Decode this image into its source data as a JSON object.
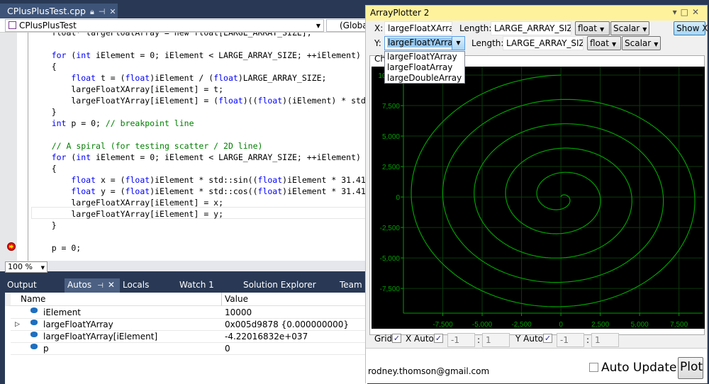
{
  "ide": {
    "doc_tab": "CPlusPlusTest.cpp",
    "nav_scope": "CPlusPlusTest",
    "nav_member": "(Global",
    "code_lines": [
      [
        [
          "    float* largeFloatArray = new float[LARGE_ARRAY_SIZE];",
          ""
        ]
      ],
      [
        [
          "",
          ""
        ]
      ],
      [
        [
          "    ",
          ""
        ],
        [
          "for",
          "kw"
        ],
        [
          " (",
          ""
        ],
        [
          "int",
          "kw"
        ],
        [
          " iElement = 0; iElement < LARGE_ARRAY_SIZE; ++iElement)",
          ""
        ]
      ],
      [
        [
          "    {",
          ""
        ]
      ],
      [
        [
          "        ",
          ""
        ],
        [
          "float",
          "kw"
        ],
        [
          " t = (",
          ""
        ],
        [
          "float",
          "kw"
        ],
        [
          ")iElement / (",
          ""
        ],
        [
          "float",
          "kw"
        ],
        [
          ")LARGE_ARRAY_SIZE;",
          ""
        ]
      ],
      [
        [
          "        largeFloatXArray[iElement] = t;",
          ""
        ]
      ],
      [
        [
          "        largeFloatYArray[iElement] = (",
          ""
        ],
        [
          "float",
          "kw"
        ],
        [
          ")((",
          ""
        ],
        [
          "float",
          "kw"
        ],
        [
          ")(iElement) * std",
          ""
        ]
      ],
      [
        [
          "    }",
          ""
        ]
      ],
      [
        [
          "    ",
          ""
        ],
        [
          "int",
          "kw"
        ],
        [
          " p = 0; ",
          ""
        ],
        [
          "// breakpoint line",
          "cm"
        ]
      ],
      [
        [
          "",
          ""
        ]
      ],
      [
        [
          "    ",
          ""
        ],
        [
          "// A spiral (for testing scatter / 2D line)",
          "cm"
        ]
      ],
      [
        [
          "    ",
          ""
        ],
        [
          "for",
          "kw"
        ],
        [
          " (",
          ""
        ],
        [
          "int",
          "kw"
        ],
        [
          " iElement = 0; iElement < LARGE_ARRAY_SIZE; ++iElement)",
          ""
        ]
      ],
      [
        [
          "    {",
          ""
        ]
      ],
      [
        [
          "        ",
          ""
        ],
        [
          "float",
          "kw"
        ],
        [
          " x = (",
          ""
        ],
        [
          "float",
          "kw"
        ],
        [
          ")iElement * std::sin((",
          ""
        ],
        [
          "float",
          "kw"
        ],
        [
          ")iElement * 31.41",
          ""
        ]
      ],
      [
        [
          "        ",
          ""
        ],
        [
          "float",
          "kw"
        ],
        [
          " y = (",
          ""
        ],
        [
          "float",
          "kw"
        ],
        [
          ")iElement * std::cos((",
          ""
        ],
        [
          "float",
          "kw"
        ],
        [
          ")iElement * 31.41",
          ""
        ]
      ],
      [
        [
          "        largeFloatXArray[iElement] = x;",
          ""
        ]
      ],
      [
        [
          "        largeFloatYArray[iElement] = y;",
          ""
        ]
      ],
      [
        [
          "    }",
          ""
        ]
      ],
      [
        [
          "",
          ""
        ]
      ],
      [
        [
          "    p = 0;",
          ""
        ]
      ]
    ],
    "zoom": "100 %",
    "panel_tabs": [
      "Output",
      "Autos",
      "Locals",
      "Watch 1",
      "Solution Explorer",
      "Team E"
    ],
    "autos": {
      "headers": [
        "Name",
        "Value"
      ],
      "rows": [
        {
          "name": "iElement",
          "value": "10000",
          "expandable": false
        },
        {
          "name": "largeFloatYArray",
          "value": "0x005d9878 {0.000000000}",
          "expandable": true
        },
        {
          "name": "largeFloatYArray[iElement]",
          "value": "-4.22016832e+037",
          "expandable": false
        },
        {
          "name": "p",
          "value": "0",
          "expandable": false
        }
      ]
    }
  },
  "plotter": {
    "title": "ArrayPlotter 2",
    "x_label": "X:",
    "x_expr": "largeFloatXArray",
    "y_label": "Y:",
    "y_expr": "largeFloatYArray",
    "length_label": "Length:",
    "x_length": "LARGE_ARRAY_SIZE",
    "y_length": "LARGE_ARRAY_SIZE",
    "x_type": "float",
    "y_type": "float",
    "x_mode": "Scalar",
    "y_mode": "Scalar",
    "show_x": "Show X",
    "y_options": [
      "largeFloatYArray",
      "largeFloatArray",
      "largeDoubleArray"
    ],
    "chart_tab": "Ch",
    "grid_label": "Grid",
    "grid_checked": true,
    "x_auto_label": "X Auto",
    "x_auto_checked": true,
    "x_min": "-1",
    "x_max": "1",
    "y_auto_label": "Y Auto",
    "y_auto_checked": true,
    "y_min": "-1",
    "y_max": "1",
    "colon": ":",
    "email": "rodney.thomson@gmail.com",
    "auto_update_label": "Auto Update",
    "auto_update_checked": false,
    "plot_button": "Plot",
    "check_mark": "✓"
  },
  "chart_data": {
    "type": "line",
    "description_source": "x = i*sin(i*pi/1000), y = i*cos(i*pi/1000), i = 0..10000",
    "parametric": {
      "count": 10000,
      "turns": 5,
      "max_radius": 10000
    },
    "xlim": [
      -10000,
      9000
    ],
    "ylim": [
      -9530,
      10700
    ],
    "x_ticks": [
      -7500,
      -5000,
      -2500,
      0,
      2500,
      5000,
      7500
    ],
    "x_tick_labels": [
      "-7,500",
      "-5,000",
      "-2,500",
      "0",
      "2,500",
      "5,000",
      "7,500"
    ],
    "y_ticks": [
      -7500,
      -5000,
      -2500,
      0,
      2500,
      5000,
      7500,
      10000
    ],
    "y_tick_labels": [
      "-7,500",
      "-5,000",
      "-2,500",
      "0",
      "2,500",
      "5,000",
      "7,500",
      "10,000"
    ],
    "grid": true,
    "colors": {
      "background": "#000000",
      "line": "#00a000",
      "grid": "#0d3a0d",
      "axis": "#00a000"
    }
  }
}
